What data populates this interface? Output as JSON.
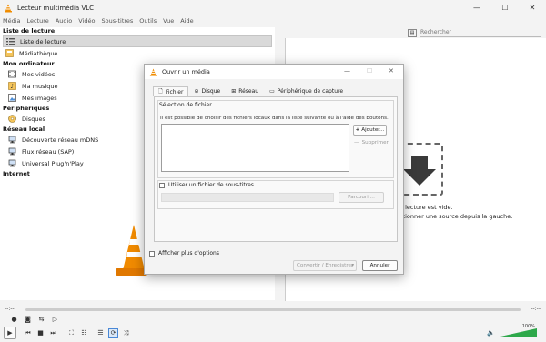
{
  "window": {
    "title": "Lecteur multimédia VLC",
    "minimize": "—",
    "maximize": "☐",
    "close": "✕"
  },
  "menu": [
    "Média",
    "Lecture",
    "Audio",
    "Vidéo",
    "Sous-titres",
    "Outils",
    "Vue",
    "Aide"
  ],
  "sidebar": {
    "sections": {
      "playlist": "Liste de lecture",
      "my_computer": "Mon ordinateur",
      "devices": "Périphériques",
      "local_network": "Réseau local",
      "internet": "Internet"
    },
    "items": {
      "playlist": "Liste de lecture",
      "library": "Médiathèque",
      "videos": "Mes vidéos",
      "music": "Ma musique",
      "images": "Mes images",
      "discs": "Disques",
      "mdns": "Découverte réseau mDNS",
      "sap": "Flux réseau (SAP)",
      "upnp": "Universal Plug'n'Play"
    }
  },
  "search": {
    "placeholder": "Rechercher"
  },
  "playlist_empty": {
    "line1": "e lecture est vide.",
    "line2": "ctionner une source depuis la gauche."
  },
  "player": {
    "time_elapsed": "--:--",
    "time_total": "--:--",
    "volume_percent": "100%",
    "volume_level": 1.0
  },
  "dialog": {
    "title": "Ouvrir un média",
    "tabs": [
      "Fichier",
      "Disque",
      "Réseau",
      "Périphérique de capture"
    ],
    "file_selection_title": "Sélection de fichier",
    "file_selection_desc": "Il est possible de choisir des fichiers locaux dans la liste suivante ou à l'aide des boutons.",
    "add_button": "Ajouter...",
    "remove_button": "Supprimer",
    "subtitle_checkbox": "Utiliser un fichier de sous-titres",
    "browse_button": "Parcourir...",
    "show_more": "Afficher plus d'options",
    "convert_button": "Convertir / Enregistrer",
    "cancel_button": "Annuler"
  }
}
